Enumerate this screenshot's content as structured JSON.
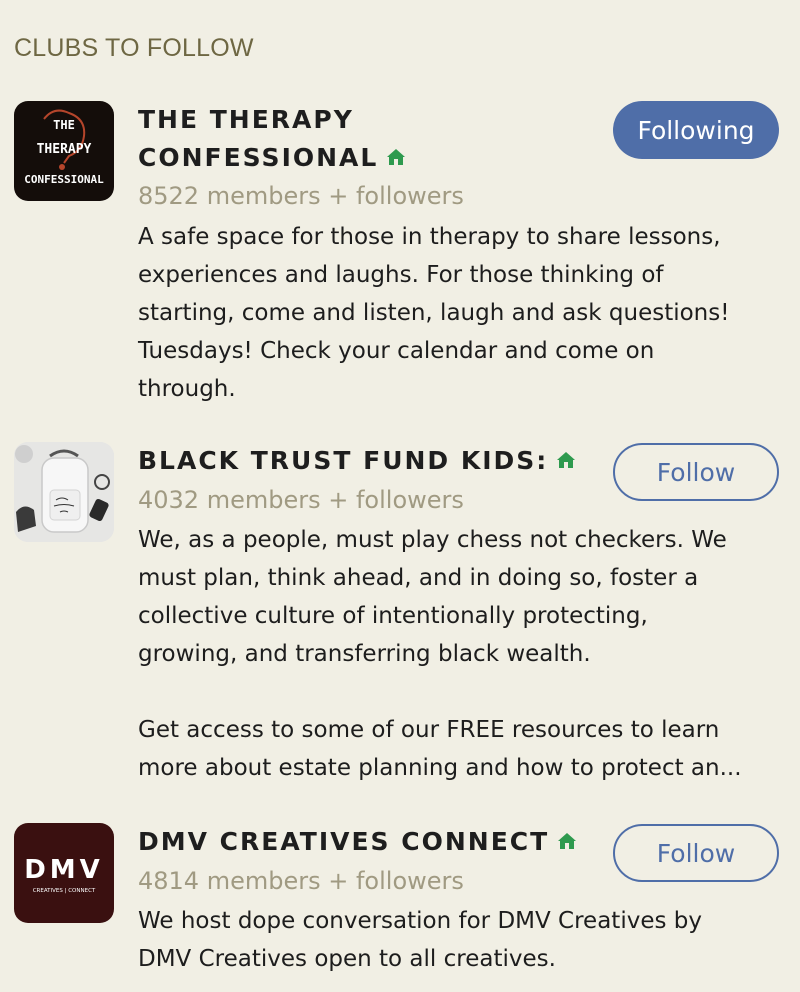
{
  "section_title": "CLUBS TO FOLLOW",
  "accent_color": "#4f6ea8",
  "house_icon_color": "#2e9a4e",
  "clubs": [
    {
      "name_line1": "THE THERAPY",
      "name_line2": "CONFESSIONAL",
      "count": "8522 members + followers",
      "description": "A safe space for those in therapy to share lessons,\nexperiences and laughs. For those thinking of\nstarting, come and listen, laugh and ask questions!\nTuesdays! Check your calendar and come on\nthrough.",
      "button": "Following",
      "avatar_text": [
        "THE",
        "THERAPY",
        "CONFESSIONAL"
      ]
    },
    {
      "name": "BLACK TRUST FUND KIDS:",
      "count": "4032 members + followers",
      "description": "We, as a people, must play chess not checkers. We\nmust plan, think ahead, and in doing so, foster a\ncollective culture of intentionally protecting,\ngrowing, and transferring black wealth.\n\nGet access to some of our FREE resources to learn\nmore about estate planning and how to protect an...",
      "button": "Follow"
    },
    {
      "name": "DMV CREATIVES CONNECT",
      "count": "4814 members + followers",
      "description": "We host dope conversation for DMV Creatives by\nDMV Creatives open to all creatives.",
      "button": "Follow",
      "avatar_text": [
        "DMV",
        "CREATIVES | CONNECT"
      ]
    }
  ]
}
